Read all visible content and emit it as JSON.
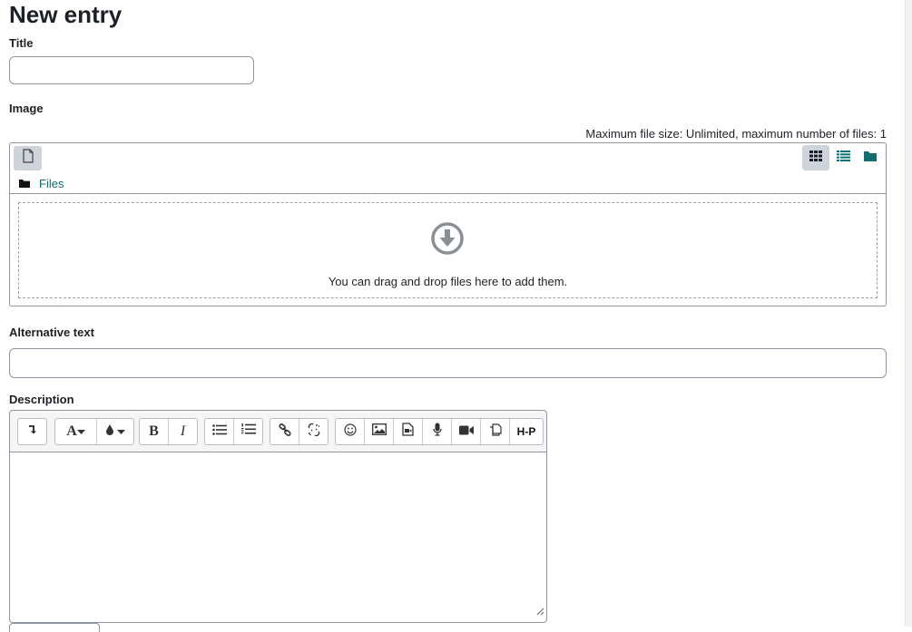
{
  "page": {
    "title": "New entry"
  },
  "form": {
    "title_label": "Title",
    "title_value": "",
    "image_label": "Image",
    "file_limits": "Maximum file size: Unlimited, maximum number of files: 1",
    "files_breadcrumb": "Files",
    "drop_message": "You can drag and drop files here to add them.",
    "alt_text_label": "Alternative text",
    "alt_text_value": "",
    "description_label": "Description"
  },
  "icons": {
    "add_file": "file-icon",
    "view_icons": "grid-icon",
    "view_list": "list-icon",
    "view_tree": "folder-icon",
    "breadcrumb": "folder-icon",
    "drop": "download-circle-icon"
  },
  "editor": {
    "toolbar_groups": [
      [
        "toggle-toolbar"
      ],
      [
        "font-style",
        "font-color"
      ],
      [
        "bold",
        "italic"
      ],
      [
        "unordered-list",
        "ordered-list"
      ],
      [
        "link",
        "unlink"
      ],
      [
        "emoji",
        "image",
        "media",
        "record-audio",
        "record-video",
        "manage-files",
        "h5p"
      ]
    ],
    "bold_glyph": "B",
    "italic_glyph": "I",
    "font_glyph": "A",
    "h5p_glyph": "H-P"
  },
  "colors": {
    "link": "#0f6e6e",
    "view_active_bg": "#ced4da",
    "border": "#8f959e"
  }
}
